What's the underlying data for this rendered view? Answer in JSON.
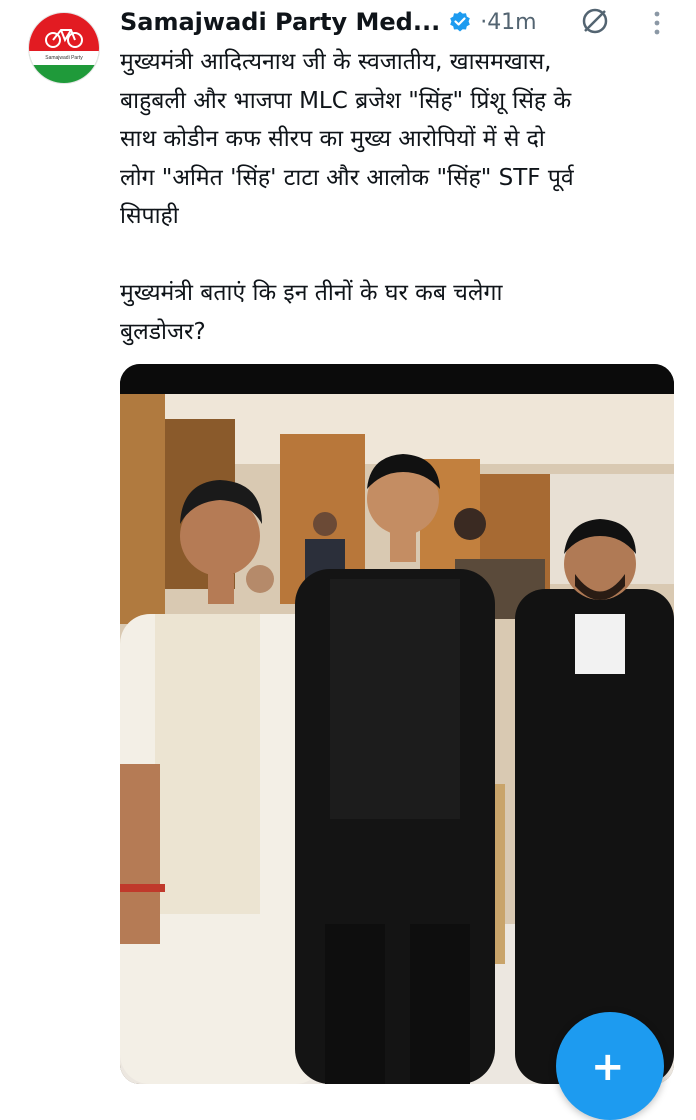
{
  "tweet": {
    "author_name": "Samajwadi Party Med...",
    "timestamp": "41m",
    "separator": "·",
    "avatar_caption": "Samajwadi Party",
    "text": "मुख्यमंत्री आदित्यनाथ जी के स्वजातीय, खासमखास,\nबाहुबली और भाजपा MLC ब्रजेश \"सिंह\" प्रिंशू सिंह के\nसाथ कोडीन कफ सीरप का मुख्य आरोपियों में से दो\nलोग \"अमित 'सिंह' टाटा और आलोक \"सिंह\" STF पूर्व\nसिपाही\n\nमुख्यमंत्री बताएं कि इन तीनों के घर कब चलेगा\nबुलडोजर?"
  },
  "icons": {
    "verified": "verified-badge-icon",
    "no_edit": "edit-slash-icon",
    "more": "more-vertical-icon",
    "compose": "plus-icon"
  },
  "fab": {
    "label": "+"
  },
  "colors": {
    "accent": "#1d9bf0",
    "party_red": "#e21b22",
    "party_green": "#1f9a3a",
    "muted_text": "#536471"
  }
}
